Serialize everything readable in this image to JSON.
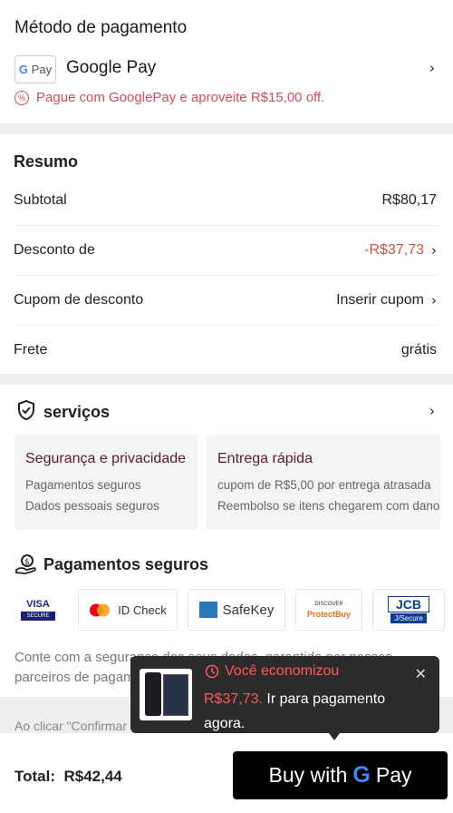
{
  "payment": {
    "title": "Método de pagamento",
    "method_badge": "G Pay",
    "method_label": "Google Pay",
    "promo_text": "Pague com GooglePay e aproveite R$15,00 off."
  },
  "summary": {
    "title": "Resumo",
    "rows": [
      {
        "label": "Subtotal",
        "value": "R$80,17"
      },
      {
        "label": "Desconto de",
        "value": "-R$37,73"
      },
      {
        "label": "Cupom de desconto",
        "value": "Inserir cupom"
      },
      {
        "label": "Frete",
        "value": "grátis"
      }
    ]
  },
  "services": {
    "title": "serviços",
    "cards": [
      {
        "heading": "Segurança e privacidade",
        "lines": [
          "Pagamentos seguros",
          "Dados pessoais seguros"
        ]
      },
      {
        "heading": "Entrega rápida",
        "lines": [
          "cupom de R$5,00 por entrega atrasada",
          "Reembolso se itens chegarem com danos"
        ]
      }
    ],
    "secure_title": "Pagamentos seguros",
    "logos": [
      "VISA",
      "SECURE",
      "ID Check",
      "SafeKey",
      "DISCOVER",
      "ProtectBuy",
      "JCB",
      "J/Secure"
    ],
    "note": "Conte com a segurança dos seus dados, garantida por nossos parceiros de pagamento.",
    "terms_fragment": "Ao clicar \"Confirmar"
  },
  "footer": {
    "total_label": "Total:",
    "total_value": "R$42,44",
    "buy_text": "Buy with",
    "buy_brand": "Pay"
  },
  "toast": {
    "headline": "Você economizou",
    "amount": "R$37,73.",
    "message": "Ir para pagamento agora."
  },
  "colors": {
    "accent_red": "#d3503e",
    "promo_red": "#d24c5a",
    "dark_button": "#000000"
  }
}
